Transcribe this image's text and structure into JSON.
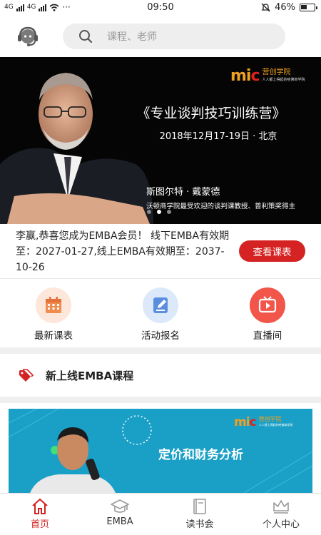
{
  "status_bar": {
    "network_left": "4G",
    "network_right": "4G",
    "more": "···",
    "time": "09:50",
    "battery": "46%"
  },
  "header": {
    "search_placeholder": "课程、老师"
  },
  "banner": {
    "logo_mark": "mic",
    "logo_name": "营创学院",
    "logo_sub": "人人都上得起的哈佛商学院",
    "title": "《专业谈判技巧训练营》",
    "date_location": "2018年12月17-19日 · 北京",
    "speaker_name": "斯图尔特 · 戴蒙德",
    "speaker_desc": "沃顿商学院最受欢迎的谈判课教授、普利策奖得主",
    "slide_count": 3,
    "active_slide": 1
  },
  "membership": {
    "notice": "李赢,恭喜您成为EMBA会员！ 线下EMBA有效期至：2027-01-27,线上EMBA有效期至：2037-10-26",
    "button": "查看课表"
  },
  "quick_entries": [
    {
      "label": "最新课表",
      "icon": "calendar-icon",
      "bg": "#fde7da",
      "color": "#f28b4e"
    },
    {
      "label": "活动报名",
      "icon": "edit-form-icon",
      "bg": "#dce9fb",
      "color": "#5b8fde"
    },
    {
      "label": "直播间",
      "icon": "tv-play-icon",
      "bg": "#f25549",
      "color": "#ffffff"
    }
  ],
  "section": {
    "title": "新上线EMBA课程"
  },
  "course_card": {
    "logo_mark": "mic",
    "logo_name": "营创学院",
    "logo_sub": "人人都上得起的哈佛商学院",
    "title": "定价和财务分析"
  },
  "tab_bar": [
    {
      "label": "首页",
      "icon": "home-icon",
      "active": true
    },
    {
      "label": "EMBA",
      "icon": "graduation-cap-icon",
      "active": false
    },
    {
      "label": "读书会",
      "icon": "book-icon",
      "active": false
    },
    {
      "label": "个人中心",
      "icon": "crown-icon",
      "active": false
    }
  ],
  "colors": {
    "brand_red": "#d52222",
    "card_blue": "#1aa0c6",
    "logo_orange": "#f0a020"
  }
}
